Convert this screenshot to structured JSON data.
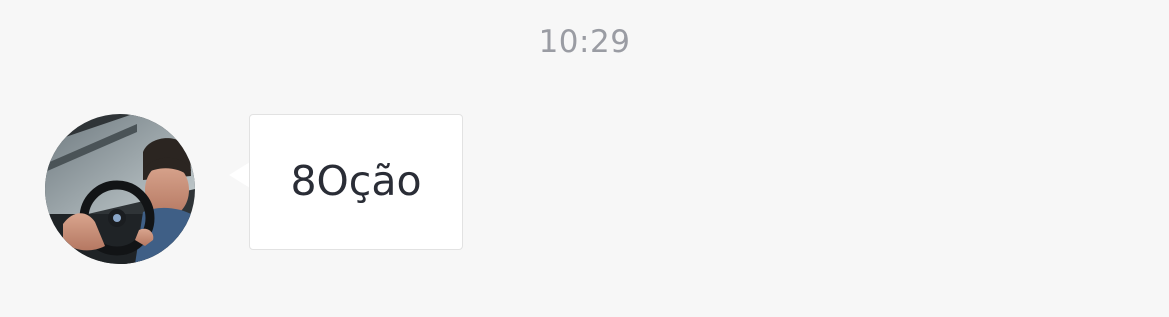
{
  "chat": {
    "timestamp": "10:29",
    "messages": [
      {
        "direction": "incoming",
        "avatar": {
          "icon": "user-photo-avatar"
        },
        "text": "8Oção"
      }
    ]
  },
  "colors": {
    "background": "#f7f7f7",
    "timestamp_text": "#9a9ca3",
    "bubble_background": "#ffffff",
    "bubble_border": "#e2e2e2",
    "message_text": "#2a2d36"
  }
}
